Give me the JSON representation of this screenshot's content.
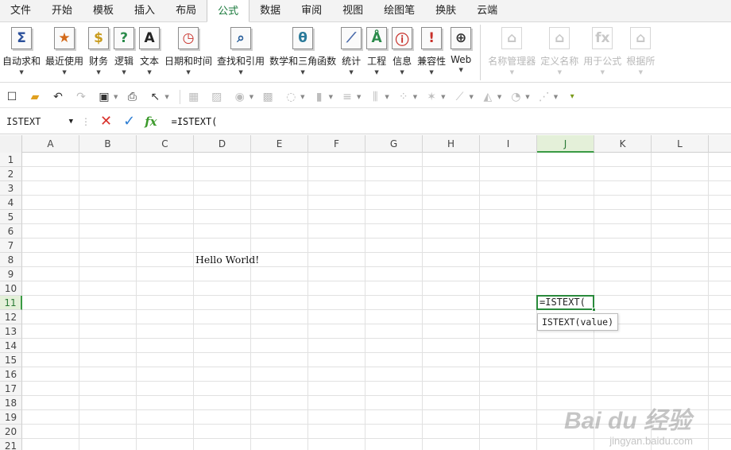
{
  "menu": {
    "tabs": [
      "文件",
      "开始",
      "模板",
      "插入",
      "布局",
      "公式",
      "数据",
      "审阅",
      "视图",
      "绘图笔",
      "换肤",
      "云端"
    ],
    "active_index": 5
  },
  "ribbon": {
    "buttons": [
      {
        "label": "自动求和",
        "icon": "sigma-icon",
        "glyph": "Σ"
      },
      {
        "label": "最近使用",
        "icon": "star-icon",
        "glyph": "★"
      },
      {
        "label": "财务",
        "icon": "money-bag-icon",
        "glyph": "$"
      },
      {
        "label": "逻辑",
        "icon": "question-icon",
        "glyph": "?"
      },
      {
        "label": "文本",
        "icon": "text-a-icon",
        "glyph": "A"
      },
      {
        "label": "日期和时间",
        "icon": "clock-icon",
        "glyph": "◷"
      },
      {
        "label": "查找和引用",
        "icon": "magnifier-icon",
        "glyph": "⌕"
      },
      {
        "label": "数学和三角函数",
        "icon": "theta-icon",
        "glyph": "θ"
      },
      {
        "label": "统计",
        "icon": "line-chart-icon",
        "glyph": "⟋"
      },
      {
        "label": "工程",
        "icon": "compass-icon",
        "glyph": "Å"
      },
      {
        "label": "信息",
        "icon": "info-icon",
        "glyph": "ⓘ"
      },
      {
        "label": "兼容性",
        "icon": "warning-icon",
        "glyph": "!"
      },
      {
        "label": "Web",
        "icon": "globe-icon",
        "glyph": "⊕"
      }
    ],
    "disabled_buttons": [
      {
        "label": "名称管理器",
        "icon": "tag-icon",
        "glyph": "⌂"
      },
      {
        "label": "定义名称",
        "icon": "tag-icon",
        "glyph": "⌂"
      },
      {
        "label": "用于公式",
        "icon": "tag-fx-icon",
        "glyph": "fx"
      },
      {
        "label": "根据所",
        "icon": "tag-icon",
        "glyph": "⌂"
      }
    ]
  },
  "formula_bar": {
    "name_box": "ISTEXT",
    "dots": "⋮",
    "cancel_glyph": "✕",
    "confirm_glyph": "✓",
    "fx_label": "fx",
    "content": "=ISTEXT("
  },
  "columns": [
    "A",
    "B",
    "C",
    "D",
    "E",
    "F",
    "G",
    "H",
    "I",
    "J",
    "K",
    "L"
  ],
  "rows": [
    "1",
    "2",
    "3",
    "4",
    "5",
    "6",
    "7",
    "8",
    "9",
    "10",
    "11",
    "12",
    "13",
    "14",
    "15",
    "16",
    "17",
    "18",
    "19",
    "20",
    "21"
  ],
  "active_column": "J",
  "active_row": "11",
  "cells": {
    "D8": "Hello World!",
    "J11": "=ISTEXT("
  },
  "tooltip": "ISTEXT(value)",
  "watermark": {
    "main": "Bai du 经验",
    "sub": "jingyan.baidu.com"
  },
  "colors": {
    "accent": "#1a7a3c",
    "active_cell_border": "#2a8a3c",
    "header_active": "#e4f0d9"
  }
}
